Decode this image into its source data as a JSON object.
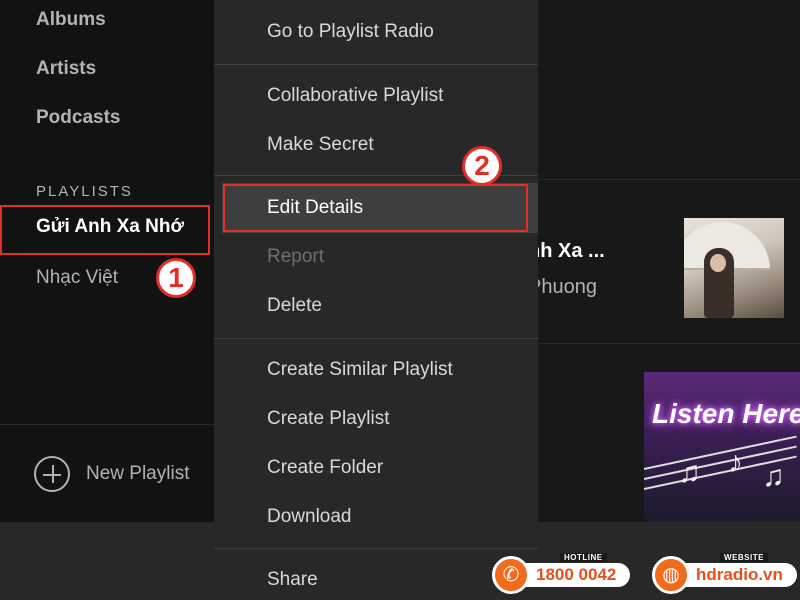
{
  "sidebar": {
    "nav": [
      {
        "label": "Albums"
      },
      {
        "label": "Artists"
      },
      {
        "label": "Podcasts"
      }
    ],
    "playlists_header": "PLAYLISTS",
    "playlists": [
      {
        "label": "Gửi Anh Xa Nhớ"
      },
      {
        "label": "Nhạc Việt"
      }
    ],
    "new_playlist_label": "New Playlist"
  },
  "annotations": {
    "step1": "1",
    "step2": "2",
    "highlight_color": "#e52d27"
  },
  "context_menu": {
    "items": [
      {
        "label": "Go to Playlist Radio",
        "state": "enabled"
      },
      {
        "label": "Collaborative Playlist",
        "state": "enabled"
      },
      {
        "label": "Make Secret",
        "state": "enabled"
      },
      {
        "label": "Edit Details",
        "state": "highlighted"
      },
      {
        "label": "Report",
        "state": "disabled"
      },
      {
        "label": "Delete",
        "state": "enabled"
      },
      {
        "label": "Create Similar Playlist",
        "state": "enabled"
      },
      {
        "label": "Create Playlist",
        "state": "enabled"
      },
      {
        "label": "Create Folder",
        "state": "enabled"
      },
      {
        "label": "Download",
        "state": "enabled"
      },
      {
        "label": "Share",
        "state": "enabled"
      }
    ]
  },
  "main": {
    "track": {
      "title": "nh Xa ...",
      "artist": "Phuong"
    },
    "cover2_text": "Listen Here"
  },
  "brand": {
    "hotline_label": "HOTLINE",
    "hotline_number": "1800 0042",
    "website_label": "WEBSITE",
    "website": "hdradio.vn",
    "accent": "#f26a1b"
  }
}
